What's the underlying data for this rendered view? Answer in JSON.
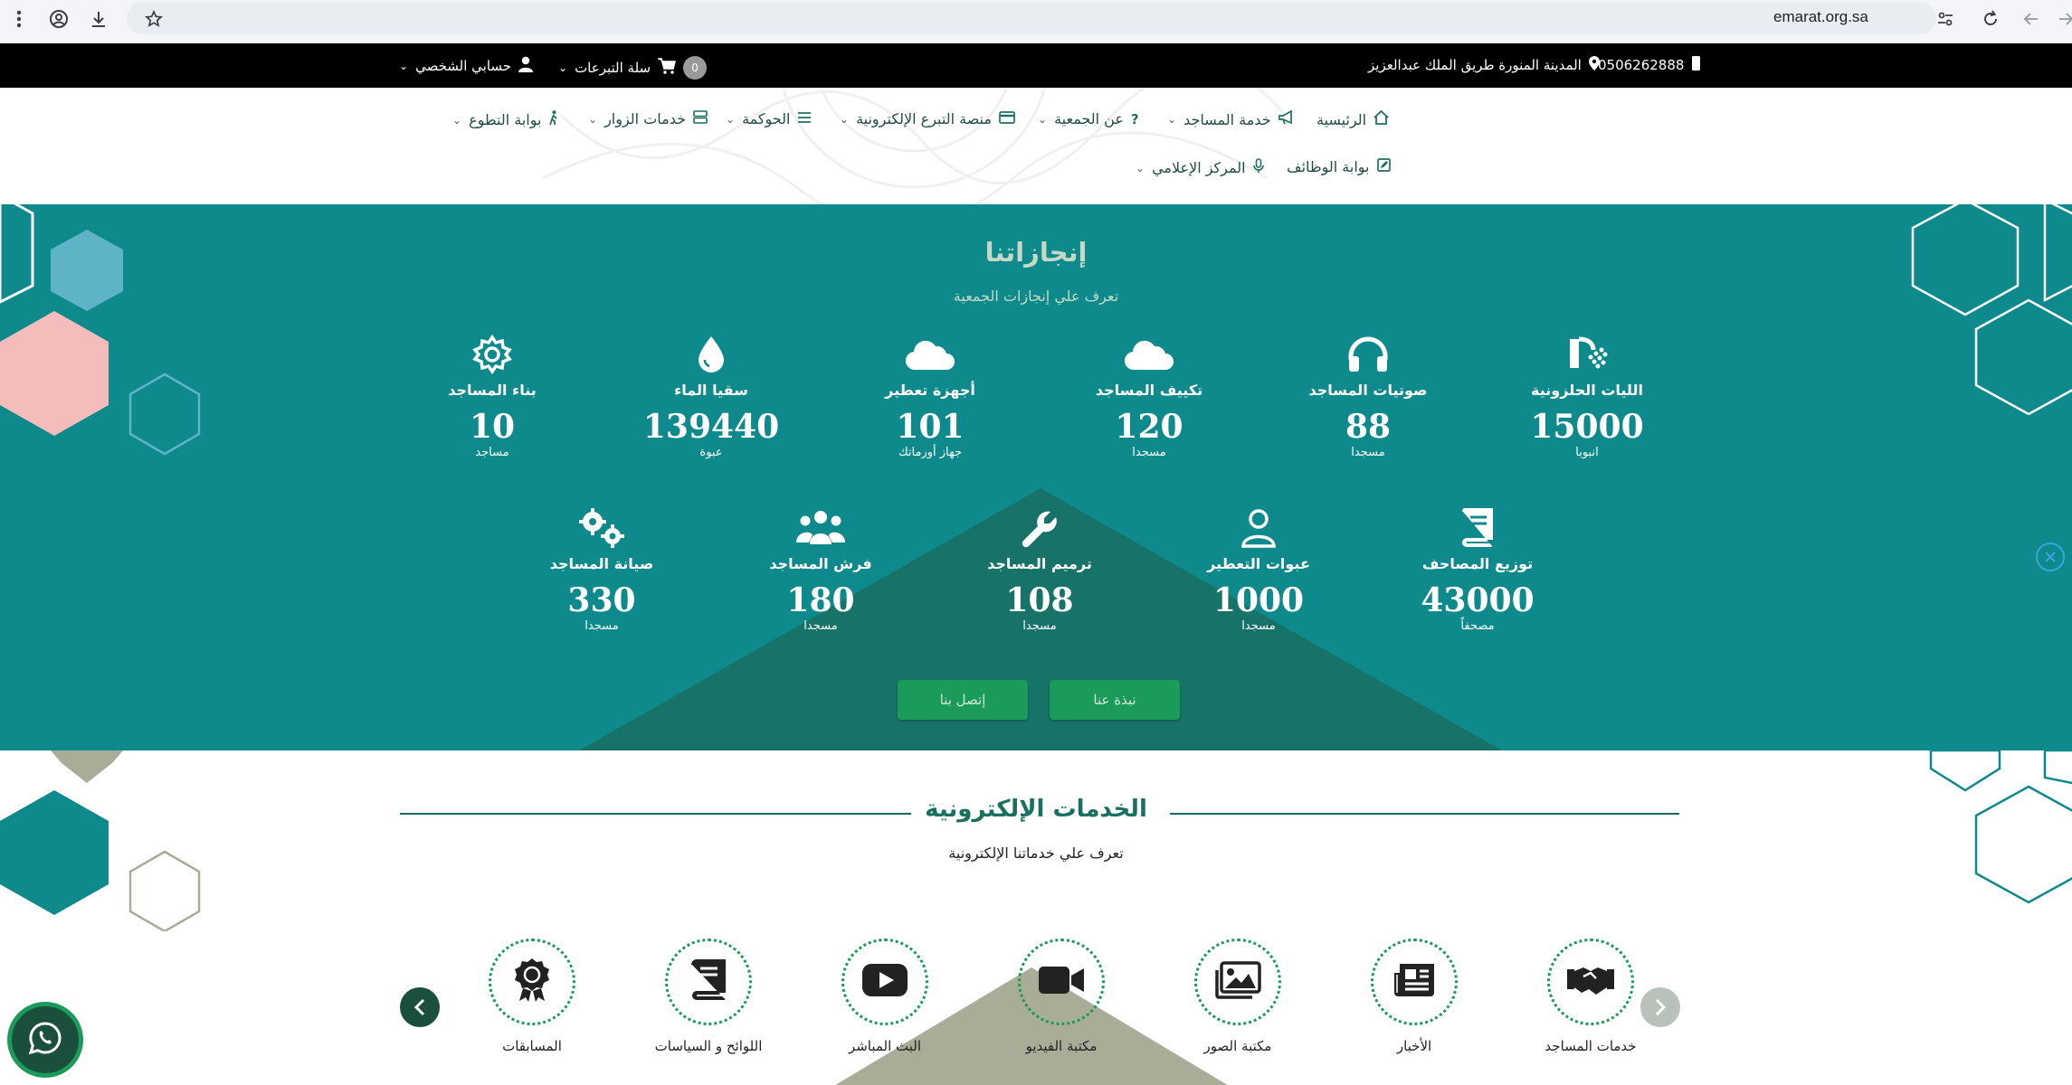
{
  "browser": {
    "url": "emarat.org.sa"
  },
  "topbar": {
    "phone": "0506262888",
    "address": "المدينة المنورة طريق الملك عبدالعزيز",
    "cart_label": "سلة التبرعات",
    "cart_count": "0",
    "account_label": "حسابي الشخصي"
  },
  "nav": {
    "row1": [
      {
        "label": "الرئيسية",
        "icon": "home-icon"
      },
      {
        "label": "خدمة المساجد",
        "icon": "megaphone-icon"
      },
      {
        "label": "عن الجمعية",
        "icon": "question-icon"
      },
      {
        "label": "منصة التبرع الإلكترونية",
        "icon": "card-icon"
      },
      {
        "label": "الحوكمة",
        "icon": "list-icon"
      },
      {
        "label": "خدمات الزوار",
        "icon": "server-icon"
      },
      {
        "label": "بوابة التطوع",
        "icon": "person-walking-icon"
      }
    ],
    "row2": [
      {
        "label": "بوابة الوظائف",
        "icon": "edit-icon"
      },
      {
        "label": "المركز الإعلامي",
        "icon": "microphone-icon"
      }
    ]
  },
  "achievements": {
    "title": "إنجازاتنا",
    "subtitle": "تعرف علي إنجازات الجمعية",
    "row1": [
      {
        "label": "الليات الحلزونية",
        "value": "15000",
        "unit": "انبوبا",
        "icon": "shower-icon"
      },
      {
        "label": "صوتيات المساجد",
        "value": "88",
        "unit": "مسجدا",
        "icon": "headphones-icon"
      },
      {
        "label": "تكييف المساجد",
        "value": "120",
        "unit": "مسجدا",
        "icon": "cloud-icon"
      },
      {
        "label": "أجهزة تعطير",
        "value": "101",
        "unit": "جهاز أورماتك",
        "icon": "cloud-icon"
      },
      {
        "label": "سقيا الماء",
        "value": "139440",
        "unit": "عبوة",
        "icon": "water-drop-icon"
      },
      {
        "label": "بناء المساجد",
        "value": "10",
        "unit": "مساجد",
        "icon": "gear-icon"
      }
    ],
    "row2": [
      {
        "label": "توزيع المصاحف",
        "value": "43000",
        "unit": "مصحفاً",
        "icon": "book-icon"
      },
      {
        "label": "عبوات التعطير",
        "value": "1000",
        "unit": "مسجدا",
        "icon": "user-icon"
      },
      {
        "label": "ترميم المساجد",
        "value": "108",
        "unit": "مسجدا",
        "icon": "wrench-icon"
      },
      {
        "label": "فرش المساجد",
        "value": "180",
        "unit": "مسجدا",
        "icon": "users-icon"
      },
      {
        "label": "صيانة المساجد",
        "value": "330",
        "unit": "مسجدا",
        "icon": "gears-icon"
      }
    ],
    "about_button": "نبذة عنا",
    "contact_button": "إتصل بنا"
  },
  "eservices": {
    "title": "الخدمات الإلكترونية",
    "subtitle": "تعرف علي خدماتنا الإلكترونية",
    "items": [
      {
        "label": "خدمات المساجد",
        "icon": "handshake-icon"
      },
      {
        "label": "الأخبار",
        "icon": "newspaper-icon"
      },
      {
        "label": "مكتبة الصور",
        "icon": "images-icon"
      },
      {
        "label": "مكتبة الفيديو",
        "icon": "video-icon"
      },
      {
        "label": "البث المباشر",
        "icon": "youtube-icon"
      },
      {
        "label": "اللوائح و السياسات",
        "icon": "book-icon"
      },
      {
        "label": "المسابقات",
        "icon": "award-icon"
      }
    ]
  },
  "colors": {
    "teal": "#0e8a8c",
    "green": "#1b9b5a",
    "dark_green": "#1a6b5f",
    "pink": "#f5bcbc",
    "khaki": "#a9ad97"
  }
}
